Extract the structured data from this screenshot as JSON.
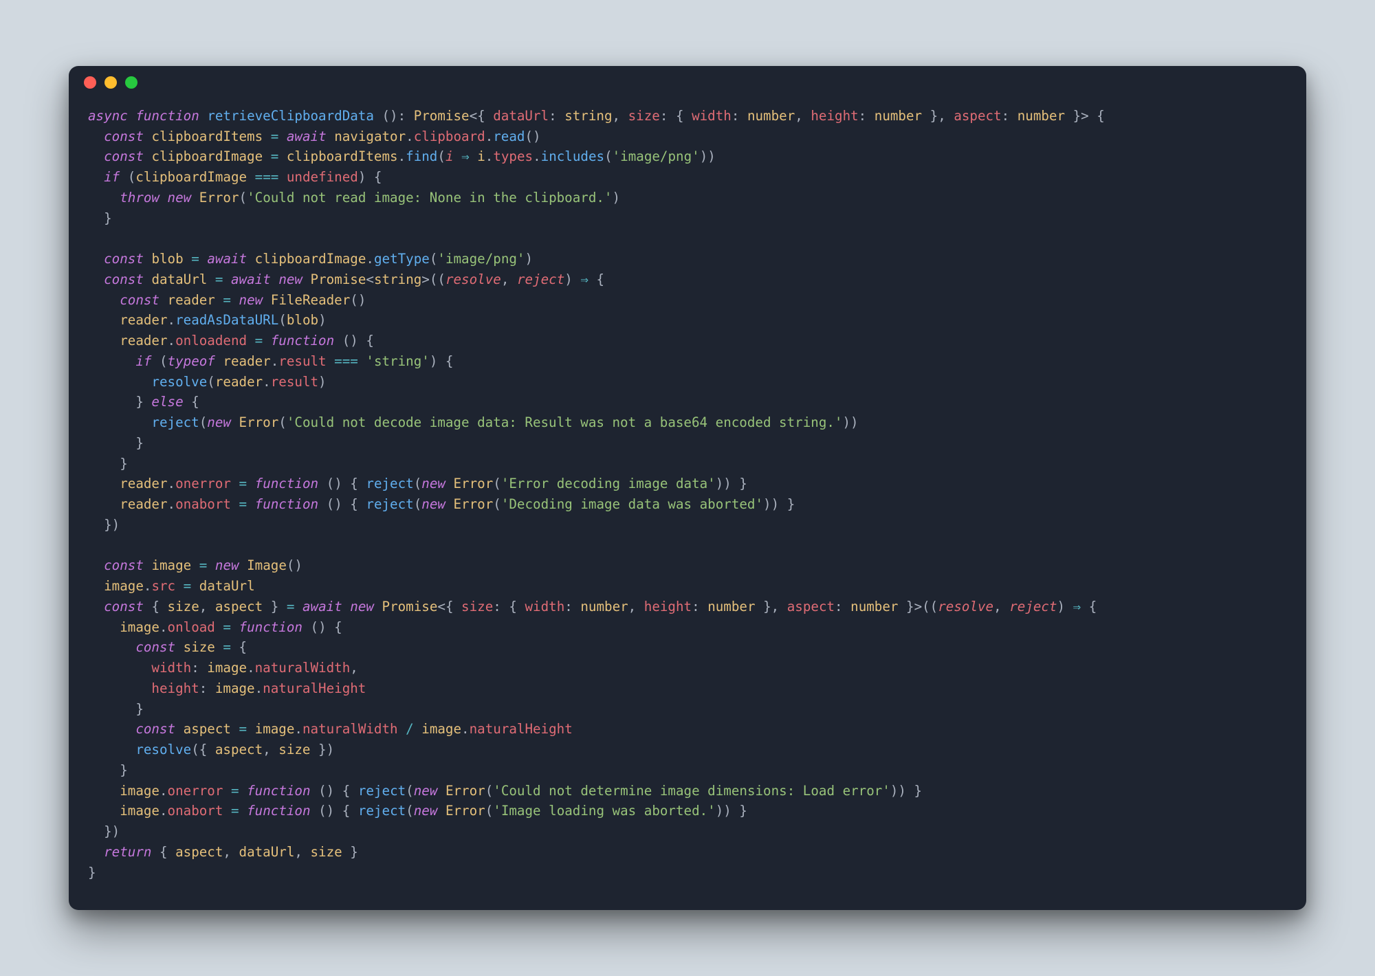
{
  "window": {
    "trafficLights": [
      "close",
      "minimize",
      "maximize"
    ]
  },
  "colors": {
    "background": "#1e2430",
    "pageBackground": "#d1d9e0",
    "red": "#ff5f56",
    "yellow": "#ffbd2e",
    "green": "#27c93f",
    "keyword": "#c678dd",
    "function": "#61afef",
    "variable": "#e5c07b",
    "property": "#e06c75",
    "string": "#98c379",
    "operator": "#56b6c2",
    "default": "#abb2bf"
  },
  "code": {
    "language": "typescript",
    "tokens": {
      "kw_async": "async",
      "kw_function": "function",
      "fn_name": "retrieveClipboardData",
      "kw_Promise": "Promise",
      "prop_dataUrl": "dataUrl",
      "type_string": "string",
      "prop_size": "size",
      "prop_width": "width",
      "type_number": "number",
      "prop_height": "height",
      "prop_aspect": "aspect",
      "kw_const": "const",
      "var_clipboardItems": "clipboardItems",
      "kw_await": "await",
      "var_navigator": "navigator",
      "prop_clipboard": "clipboard",
      "fn_read": "read",
      "var_clipboardImage": "clipboardImage",
      "fn_find": "find",
      "param_i": "i",
      "op_arrow": "⇒",
      "prop_types": "types",
      "fn_includes": "includes",
      "str_imgpng": "'image/png'",
      "kw_if": "if",
      "op_eq3": "===",
      "kw_undefined": "undefined",
      "kw_throw": "throw",
      "kw_new": "new",
      "cls_Error": "Error",
      "str_noimage": "'Could not read image: None in the clipboard.'",
      "var_blob": "blob",
      "fn_getType": "getType",
      "var_dataUrl": "dataUrl",
      "param_resolve": "resolve",
      "param_reject": "reject",
      "var_reader": "reader",
      "cls_FileReader": "FileReader",
      "fn_readAsDataURL": "readAsDataURL",
      "prop_onloadend": "onloadend",
      "kw_typeof": "typeof",
      "prop_result": "result",
      "str_string": "'string'",
      "fn_resolve": "resolve",
      "kw_else": "else",
      "fn_reject": "reject",
      "str_decode": "'Could not decode image data: Result was not a base64 encoded string.'",
      "prop_onerror": "onerror",
      "str_errdecode": "'Error decoding image data'",
      "prop_onabort": "onabort",
      "str_abortdecode": "'Decoding image data was aborted'",
      "var_image": "image",
      "cls_Image": "Image",
      "prop_src": "src",
      "var_size": "size",
      "var_aspect": "aspect",
      "prop_onload": "onload",
      "prop_naturalWidth": "naturalWidth",
      "prop_naturalHeight": "naturalHeight",
      "op_div": "/",
      "str_loaderr": "'Could not determine image dimensions: Load error'",
      "str_loadabort": "'Image loading was aborted.'",
      "kw_return": "return"
    }
  }
}
